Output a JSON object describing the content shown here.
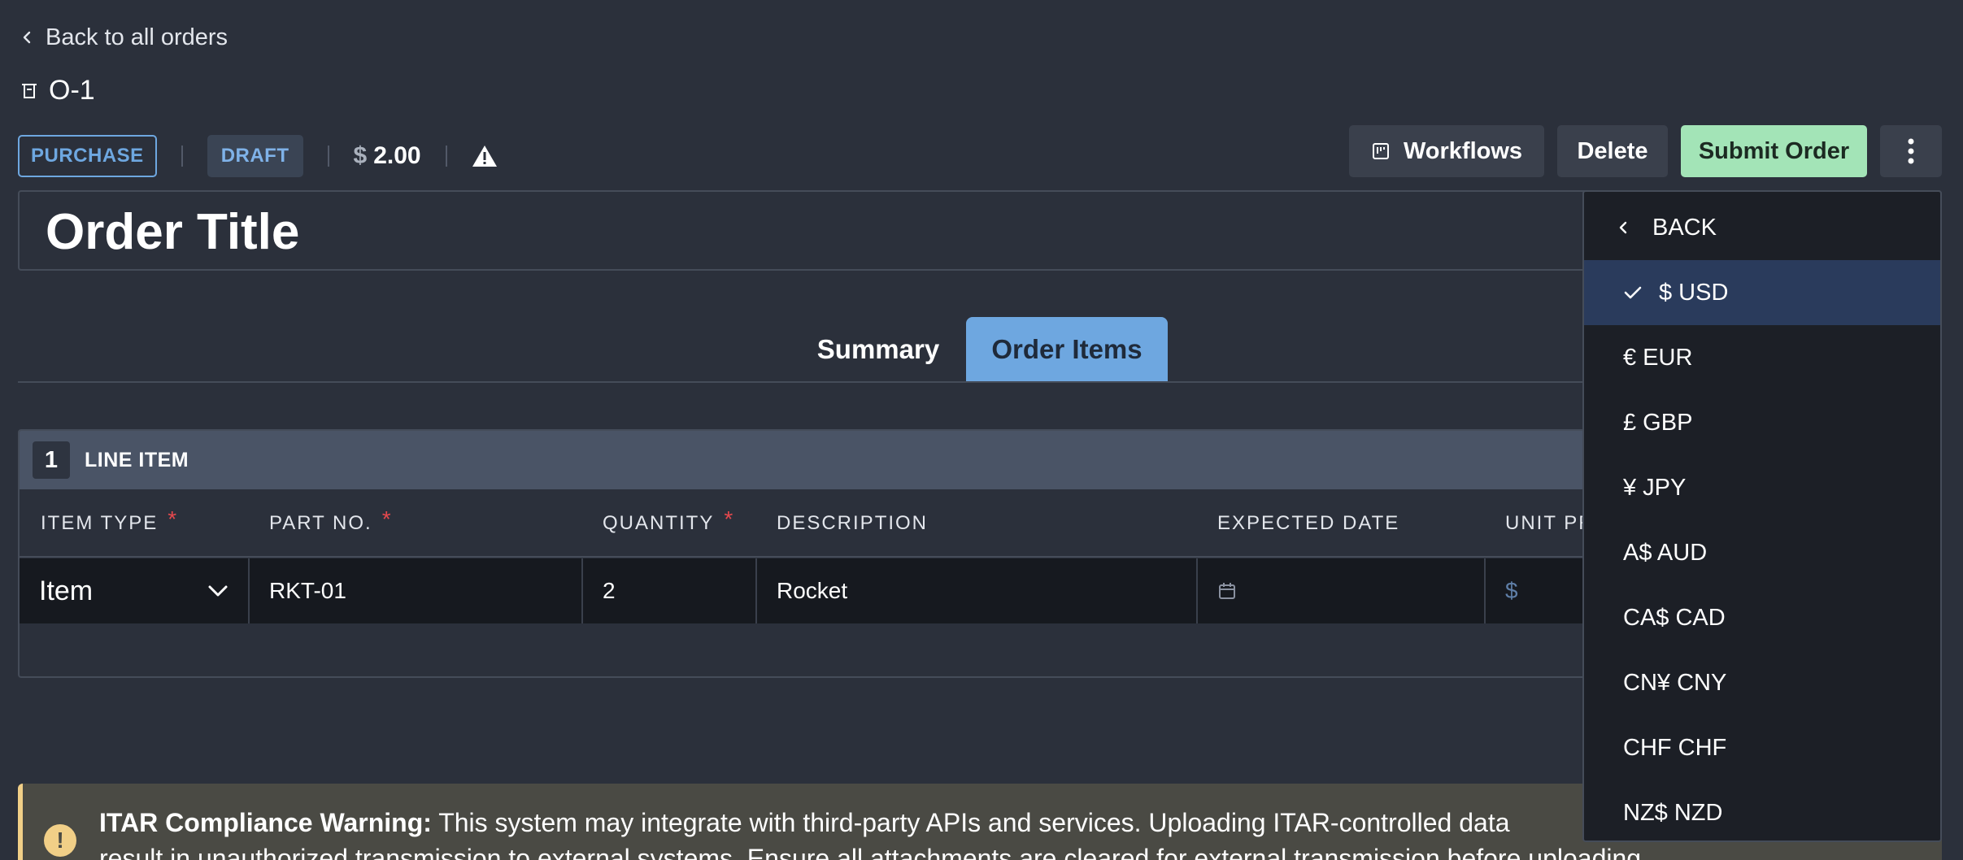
{
  "nav": {
    "back_label": "Back to all orders"
  },
  "order": {
    "id": "O-1",
    "title": "Order Title"
  },
  "meta": {
    "type_badge": "PURCHASE",
    "status_badge": "DRAFT",
    "currency_symbol": "$",
    "total": "2.00"
  },
  "actions": {
    "workflows": "Workflows",
    "delete": "Delete",
    "submit": "Submit Order"
  },
  "tabs": [
    {
      "label": "Summary",
      "active": false
    },
    {
      "label": "Order Items",
      "active": true
    }
  ],
  "line_items": {
    "count": "1",
    "label": "LINE ITEM",
    "columns": [
      {
        "label": "ITEM TYPE",
        "required": "*"
      },
      {
        "label": "PART NO.",
        "required": "*"
      },
      {
        "label": "QUANTITY",
        "required": "*"
      },
      {
        "label": "DESCRIPTION"
      },
      {
        "label": "EXPECTED DATE"
      },
      {
        "label": "UNIT PR"
      }
    ],
    "rows": [
      {
        "item_type": "Item",
        "part_no": "RKT-01",
        "quantity": "2",
        "description": "Rocket",
        "expected_date": "",
        "unit_price_symbol": "$"
      }
    ]
  },
  "warning": {
    "title": "ITAR Compliance Warning:",
    "body": " This system may integrate with third-party APIs and services. Uploading ITAR-controlled data",
    "body2": "result in unauthorized transmission to external systems. Ensure all attachments are cleared for external transmission before uploading"
  },
  "currency_menu": {
    "back_label": "BACK",
    "selected": "$ USD",
    "options": [
      "€ EUR",
      "£ GBP",
      "¥ JPY",
      "A$ AUD",
      "CA$ CAD",
      "CN¥ CNY",
      "CHF CHF",
      "NZ$ NZD"
    ]
  },
  "colors": {
    "background": "#2b303b",
    "accent_blue": "#6ea7e0",
    "submit_green": "#a3e4b7",
    "required_red": "#e5484d",
    "warning_yellow": "#f1cf87",
    "selected_menu": "#2a3b5c"
  },
  "icons": {
    "back": "chevron-left-icon",
    "order": "order-icon",
    "alert": "warning-triangle-icon",
    "workflows": "workflows-icon",
    "more": "more-vertical-icon",
    "dropdown": "chevron-down-icon",
    "date": "calendar-icon",
    "check": "check-icon",
    "info": "exclamation-circle-icon"
  }
}
